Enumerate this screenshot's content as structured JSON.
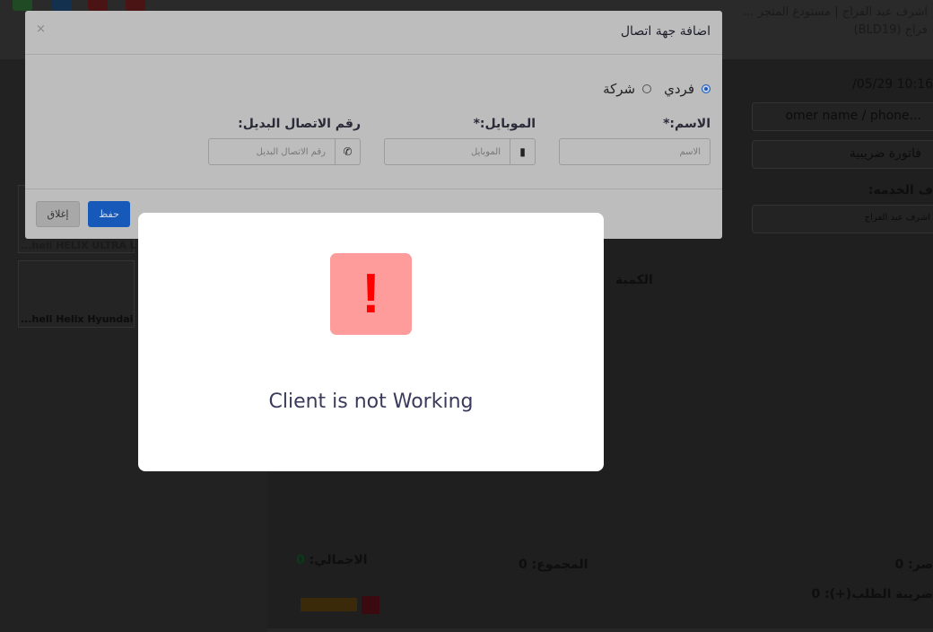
{
  "background": {
    "user_line": "اشرف عبد الفراج | مستودع المتجر ...",
    "branch_line": "فراج (BLD19)",
    "datetime": "10:16 05/29/",
    "customer_placeholder": "...omer name / phone",
    "invoice_type": "فاتورة ضريبية",
    "service_label": "ف الخدمه:",
    "service_value": "اشرف عبد الفراج",
    "quantity_header": "الكمية",
    "products": [
      "...hell HELIX ULTRA L",
      "...hell Helix Hyundai"
    ],
    "total_label": "الاجمالي:",
    "total_value": "0",
    "sum_label": "المجموع:",
    "sum_value": "0",
    "discount_label": "صر:",
    "discount_value": "0",
    "tax_label": "ضريبة الطلب(+):",
    "tax_value": "0"
  },
  "modal": {
    "title": "اضافة جهة اتصال",
    "close": "×",
    "radio_individual": "فردي",
    "radio_company": "شركة",
    "name_label": "الاسم:*",
    "name_placeholder": "الاسم",
    "mobile_label": "الموبايل:*",
    "mobile_placeholder": "الموبايل",
    "alt_label": "رقم الاتصال البديل:",
    "alt_placeholder": "رقم الاتصال البديل",
    "save": "حفظ",
    "close_button": "إغلاق"
  },
  "alert": {
    "icon": "!",
    "message": "Client is not Working"
  }
}
